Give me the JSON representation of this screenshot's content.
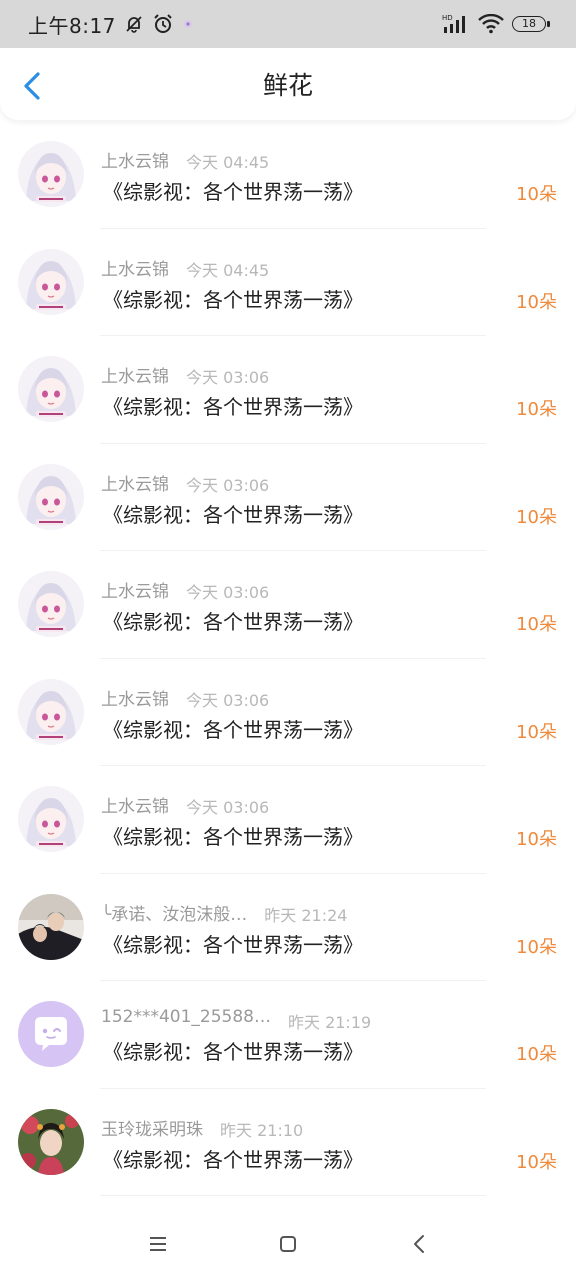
{
  "status_bar": {
    "time": "上午8:17",
    "battery": "18",
    "icons": [
      "mute-bell-icon",
      "alarm-icon",
      "app-notification-icon",
      "hd-signal-icon",
      "wifi-icon",
      "battery-icon"
    ]
  },
  "header": {
    "title": "鲜花",
    "back_icon": "chevron-left-icon",
    "accent": "#2b8ee6"
  },
  "colors": {
    "flower_count": "#ef8a3c",
    "name": "#9a9a9a",
    "time": "#b8b8b8"
  },
  "records": [
    {
      "name": "上水云锦",
      "time": "今天 04:45",
      "book": "《综影视：各个世界荡一荡》",
      "count": "10朵",
      "avatar": "anime-girl-avatar"
    },
    {
      "name": "上水云锦",
      "time": "今天 04:45",
      "book": "《综影视：各个世界荡一荡》",
      "count": "10朵",
      "avatar": "anime-girl-avatar"
    },
    {
      "name": "上水云锦",
      "time": "今天 03:06",
      "book": "《综影视：各个世界荡一荡》",
      "count": "10朵",
      "avatar": "anime-girl-avatar"
    },
    {
      "name": "上水云锦",
      "time": "今天 03:06",
      "book": "《综影视：各个世界荡一荡》",
      "count": "10朵",
      "avatar": "anime-girl-avatar"
    },
    {
      "name": "上水云锦",
      "time": "今天 03:06",
      "book": "《综影视：各个世界荡一荡》",
      "count": "10朵",
      "avatar": "anime-girl-avatar"
    },
    {
      "name": "上水云锦",
      "time": "今天 03:06",
      "book": "《综影视：各个世界荡一荡》",
      "count": "10朵",
      "avatar": "anime-girl-avatar"
    },
    {
      "name": "上水云锦",
      "time": "今天 03:06",
      "book": "《综影视：各个世界荡一荡》",
      "count": "10朵",
      "avatar": "anime-girl-avatar"
    },
    {
      "name": "╰承诺、汝泡沫般…",
      "time": "昨天 21:24",
      "book": "《综影视：各个世界荡一荡》",
      "count": "10朵",
      "avatar": "photo-couple-avatar"
    },
    {
      "name": "152***401_25588…",
      "time": "昨天 21:19",
      "book": "《综影视：各个世界荡一荡》",
      "count": "10朵",
      "avatar": "chat-bubble-avatar"
    },
    {
      "name": "玉玲珑采明珠",
      "time": "昨天 21:10",
      "book": "《综影视：各个世界荡一荡》",
      "count": "10朵",
      "avatar": "photo-woman-avatar"
    }
  ],
  "nav_bar": {
    "icons": [
      "menu-icon",
      "home-square-icon",
      "back-triangle-icon"
    ]
  }
}
